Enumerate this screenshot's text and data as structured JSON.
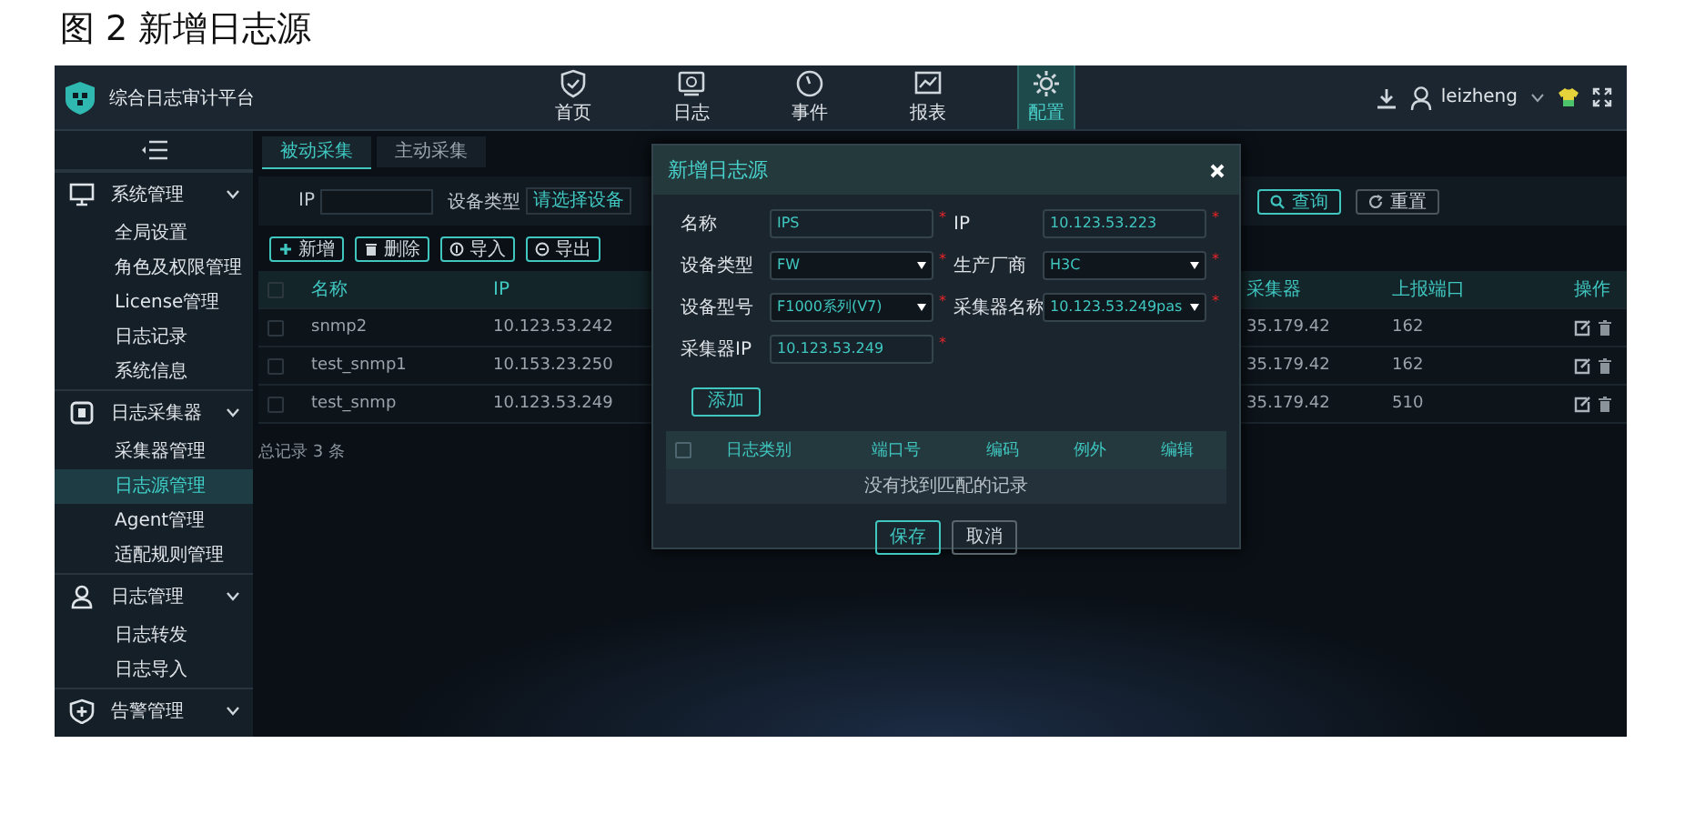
{
  "figure_caption": "图 2  新增日志源",
  "app": {
    "title": "综合日志审计平台",
    "nav": [
      {
        "label": "首页",
        "selected": false
      },
      {
        "label": "日志",
        "selected": false
      },
      {
        "label": "事件",
        "selected": false
      },
      {
        "label": "报表",
        "selected": false
      },
      {
        "label": "配置",
        "selected": true
      }
    ],
    "user": "leizheng"
  },
  "sidebar": {
    "groups": [
      {
        "label": "系统管理",
        "children": [
          {
            "label": "全局设置",
            "selected": false
          },
          {
            "label": "角色及权限管理",
            "selected": false
          },
          {
            "label": "License管理",
            "selected": false
          },
          {
            "label": "日志记录",
            "selected": false
          },
          {
            "label": "系统信息",
            "selected": false
          }
        ]
      },
      {
        "label": "日志采集器",
        "children": [
          {
            "label": "采集器管理",
            "selected": false
          },
          {
            "label": "日志源管理",
            "selected": true
          },
          {
            "label": "Agent管理",
            "selected": false
          },
          {
            "label": "适配规则管理",
            "selected": false
          }
        ]
      },
      {
        "label": "日志管理",
        "children": [
          {
            "label": "日志转发",
            "selected": false
          },
          {
            "label": "日志导入",
            "selected": false
          }
        ]
      },
      {
        "label": "告警管理"
      }
    ]
  },
  "tabs": [
    {
      "label": "被动采集",
      "selected": true
    },
    {
      "label": "主动采集",
      "selected": false
    }
  ],
  "filters": {
    "ip_label": "IP",
    "device_type_label": "设备类型",
    "device_type_placeholder": "请选择设备",
    "query": "查询",
    "reset": "重置"
  },
  "toolbar": [
    "新增",
    "删除",
    "导入",
    "导出"
  ],
  "table": {
    "header_checked": false,
    "columns": [
      "名称",
      "IP",
      "采集器",
      "上报端口",
      "操作"
    ],
    "rows": [
      {
        "checked": false,
        "name": "snmp2",
        "ip": "10.123.53.242",
        "collector": "35.179.42",
        "port": "162"
      },
      {
        "checked": false,
        "name": "test_snmp1",
        "ip": "10.153.23.250",
        "collector": "35.179.42",
        "port": "162"
      },
      {
        "checked": false,
        "name": "test_snmp",
        "ip": "10.123.53.249",
        "collector": "35.179.42",
        "port": "510"
      }
    ],
    "total": "总记录 3 条"
  },
  "dialog": {
    "title": "新增日志源",
    "fields": [
      {
        "label": "名称",
        "kind": "input",
        "value": "IPS",
        "mark": "*"
      },
      {
        "label": "IP",
        "kind": "input",
        "value": "10.123.53.223",
        "mark": "*"
      },
      {
        "label": "设备类型",
        "kind": "select",
        "value": "FW",
        "mark": "*"
      },
      {
        "label": "生产厂商",
        "kind": "select",
        "value": "H3C",
        "mark": "*"
      },
      {
        "label": "设备型号",
        "kind": "select",
        "value": "F1000系列(V7)",
        "mark": "*"
      },
      {
        "label": "采集器名称",
        "kind": "select",
        "value": "10.123.53.249pas",
        "mark": "*"
      },
      {
        "label": "采集器IP",
        "kind": "input",
        "value": "10.123.53.249",
        "mark": "*"
      }
    ],
    "add_button": "添加",
    "subtable": {
      "header_checked": false,
      "columns": [
        "日志类别",
        "端口号",
        "编码",
        "例外",
        "编辑"
      ],
      "empty": "没有找到匹配的记录"
    },
    "buttons": [
      "保存",
      "取消"
    ]
  }
}
